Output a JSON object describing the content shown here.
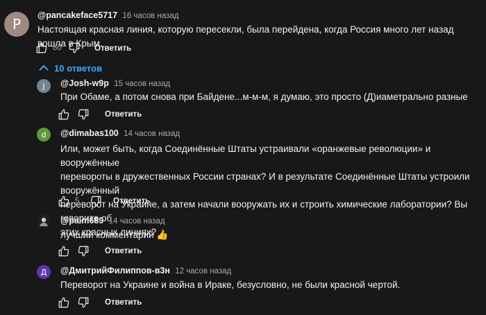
{
  "main_comment": {
    "avatar_letter": "P",
    "avatar_color": "#9e8a80",
    "author": "@pancakeface5717",
    "time": "16 часов назад",
    "text": "Настоящая красная линия, которую пересекли, была перейдена, когда Россия много лет назад вошла в Крым.",
    "likes": "80",
    "reply_label": "Ответить"
  },
  "replies_toggle": {
    "label": "10 ответов",
    "color": "#3ea6ff"
  },
  "replies": [
    {
      "avatar_letter": "J",
      "avatar_color": "#6f8595",
      "author": "@Josh-w9p",
      "time": "15 часов назад",
      "text": "При Обаме, а потом снова при Байдене...м-м-м, я думаю, это просто (Д)иаметрально разные",
      "likes": "",
      "reply_label": "Ответить"
    },
    {
      "avatar_letter": "d",
      "avatar_color": "#5e9a3c",
      "author": "@dimabas100",
      "time": "14 часов назад",
      "text_lines": [
        "Или, может быть, когда Соединённые Штаты устраивали «оранжевые революции» и вооружённые",
        "перевороты в дружественных России странах? И в результате Соединённые Штаты устроили вооружённый",
        "переворот на Украине, а затем начали вооружать их и строить химические лаборатории? Вы говорите об",
        "этих красных линиях?"
      ],
      "likes": "5",
      "reply_label": "Ответить"
    },
    {
      "avatar_letter": "",
      "avatar_color": "#2a2a2a",
      "author": "@paim689",
      "time": "14 часов назад",
      "text": "лучший комментарий",
      "emoji": "👍",
      "likes": "",
      "reply_label": "Ответить"
    },
    {
      "avatar_letter": "Д",
      "avatar_color": "#5e35b1",
      "author": "@ДмитрийФилиппов-в3н",
      "time": "12 часов назад",
      "text": "Переворот на Украине и война в Ираке, безусловно, не были красной чертой.",
      "likes": "",
      "reply_label": "Ответить"
    }
  ],
  "icons": {
    "like": "thumb-up-icon",
    "dislike": "thumb-down-icon",
    "collapse": "chevron-up-icon"
  }
}
